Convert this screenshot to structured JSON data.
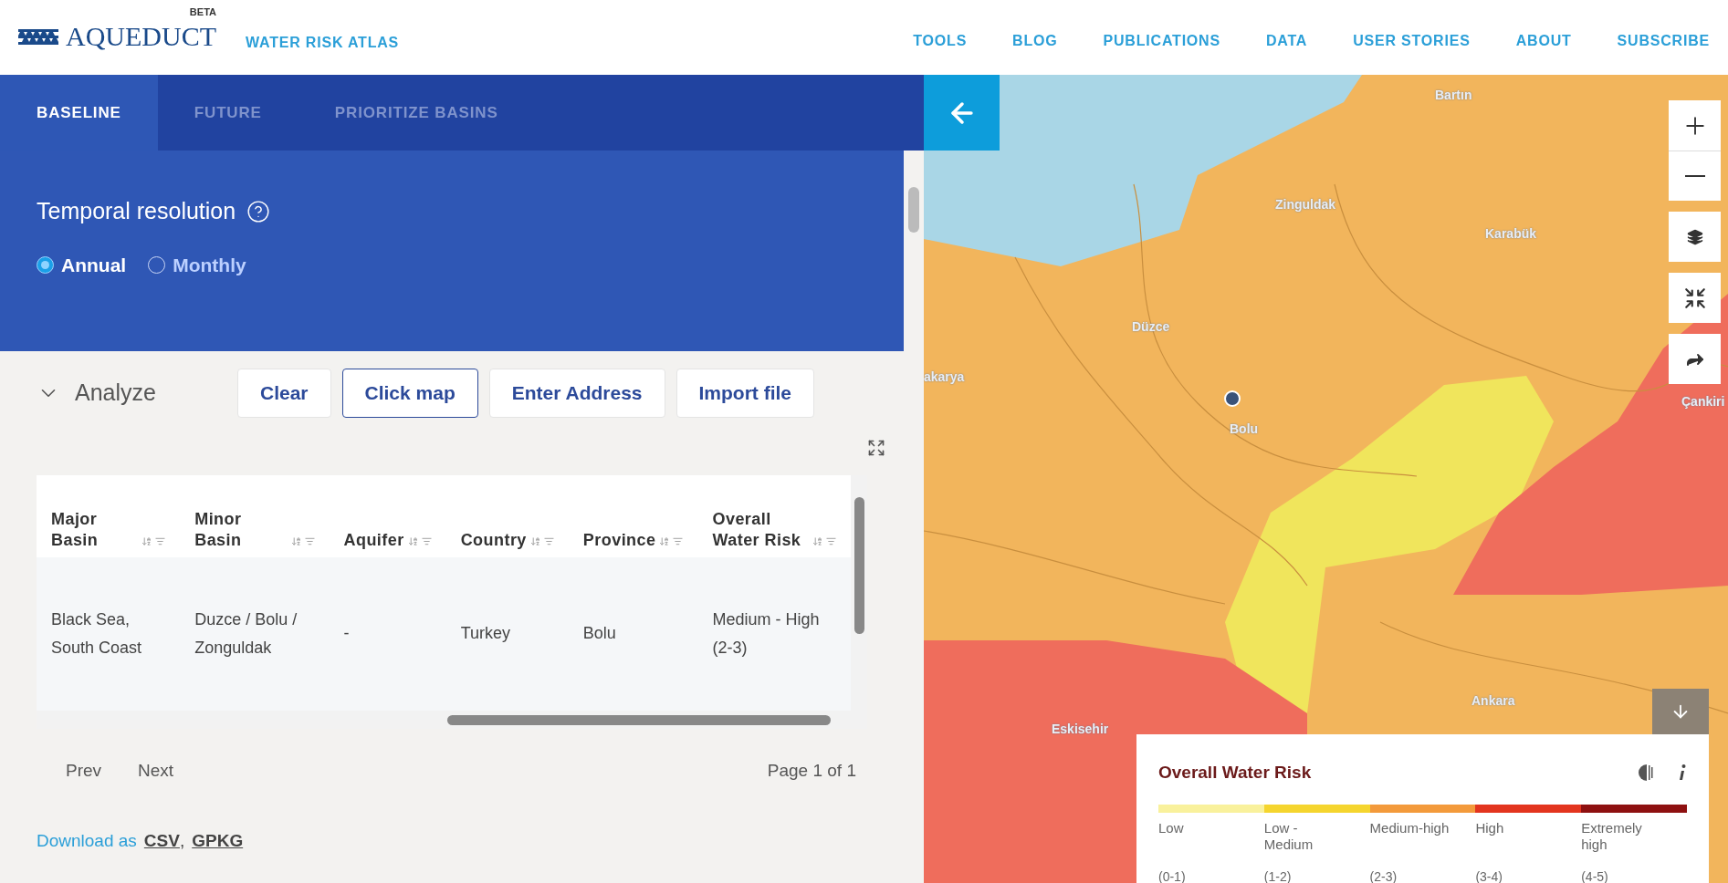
{
  "header": {
    "logo": "AQUEDUCT",
    "badge": "BETA",
    "subtitle": "WATER RISK ATLAS",
    "nav": [
      "TOOLS",
      "BLOG",
      "PUBLICATIONS",
      "DATA",
      "USER STORIES",
      "ABOUT",
      "SUBSCRIBE"
    ]
  },
  "tabs": [
    {
      "label": "BASELINE",
      "selected": true
    },
    {
      "label": "FUTURE",
      "selected": false
    },
    {
      "label": "PRIORITIZE BASINS",
      "selected": false
    }
  ],
  "temporal": {
    "title": "Temporal resolution",
    "options": [
      {
        "label": "Annual",
        "selected": true
      },
      {
        "label": "Monthly",
        "selected": false
      }
    ]
  },
  "analyze": {
    "label": "Analyze",
    "expanded": true,
    "buttons": [
      {
        "label": "Clear",
        "selected": false
      },
      {
        "label": "Click map",
        "selected": true
      },
      {
        "label": "Enter Address",
        "selected": false
      },
      {
        "label": "Import file",
        "selected": false
      }
    ]
  },
  "table": {
    "columns": [
      "Major Basin",
      "Minor Basin",
      "Aquifer",
      "Country",
      "Province",
      "Overall Water Risk"
    ],
    "rows": [
      [
        "Black Sea, South Coast",
        "Duzce / Bolu / Zonguldak",
        "-",
        "Turkey",
        "Bolu",
        "Medium - High (2-3)"
      ]
    ]
  },
  "pager": {
    "prev": "Prev",
    "next": "Next",
    "page": "Page 1 of 1"
  },
  "download": {
    "label": "Download as",
    "links": [
      {
        "label": "CSV",
        "separator": ","
      },
      {
        "label": "GPKG"
      }
    ]
  },
  "map": {
    "places": [
      "Bartın",
      "Zinguldak",
      "Karabük",
      "Düzce",
      "akarya",
      "Bolu",
      "Çankiri",
      "Ankara",
      "Eskisehir"
    ],
    "legend": {
      "title": "Overall Water Risk",
      "items": [
        {
          "label": "Low",
          "range": "(0-1)",
          "color": "#f9f19c"
        },
        {
          "label": "Low - Medium",
          "range": "(1-2)",
          "color": "#f5d52e"
        },
        {
          "label": "Medium-high",
          "range": "(2-3)",
          "color": "#f39a3b"
        },
        {
          "label": "High",
          "range": "(3-4)",
          "color": "#e3351f"
        },
        {
          "label": "Extremely high",
          "range": "(4-5)",
          "color": "#8e1010"
        }
      ]
    }
  }
}
